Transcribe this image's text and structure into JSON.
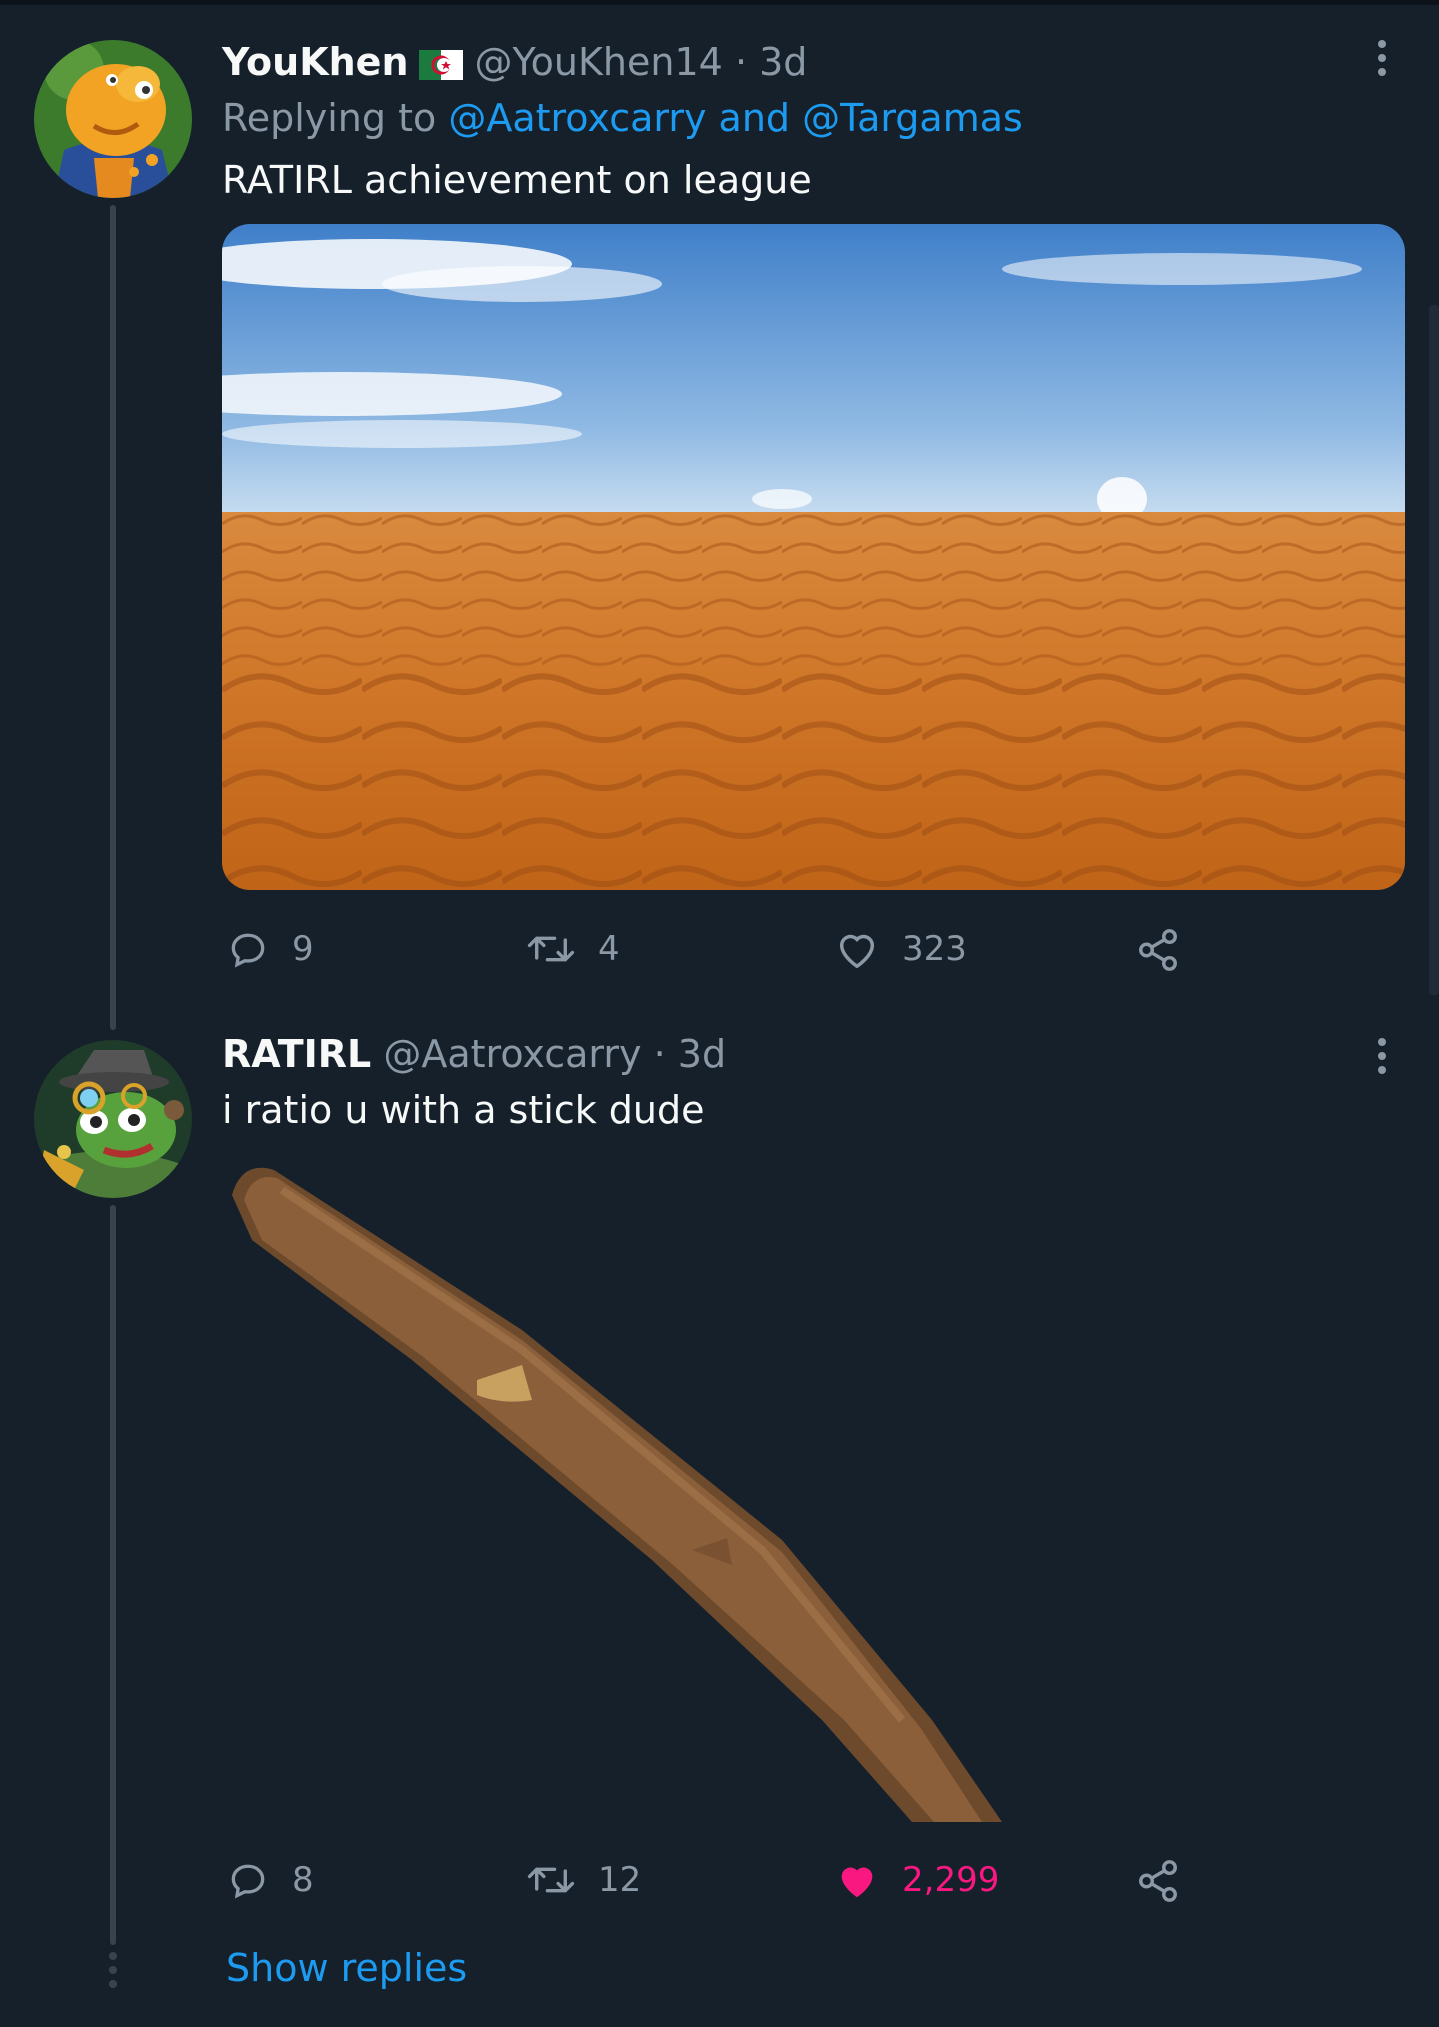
{
  "tweets": [
    {
      "name": "YouKhen",
      "handle": "@YouKhen14",
      "separator": "·",
      "time": "3d",
      "flag_colors": {
        "green": "#1b7a3e",
        "white": "#ffffff",
        "red": "#d21034"
      },
      "replying_prefix": "Replying to",
      "replying_users": [
        "@Aatroxcarry",
        "@Targamas"
      ],
      "replying_conjunction": "and",
      "text": "RATIRL achievement on league",
      "media_icon": "desert-photo",
      "actions": {
        "replies": "9",
        "retweets": "4",
        "likes": "323"
      },
      "liked": false
    },
    {
      "name": "RATIRL",
      "handle": "@Aatroxcarry",
      "separator": "·",
      "time": "3d",
      "text": "i ratio u with a stick dude",
      "media_icon": "stick-photo",
      "actions": {
        "replies": "8",
        "retweets": "12",
        "likes": "2,299"
      },
      "liked": true
    }
  ],
  "show_replies": "Show replies",
  "colors": {
    "background": "#15202b",
    "accent": "#1d9bf0",
    "like": "#f91880",
    "muted": "#8b98a5"
  }
}
